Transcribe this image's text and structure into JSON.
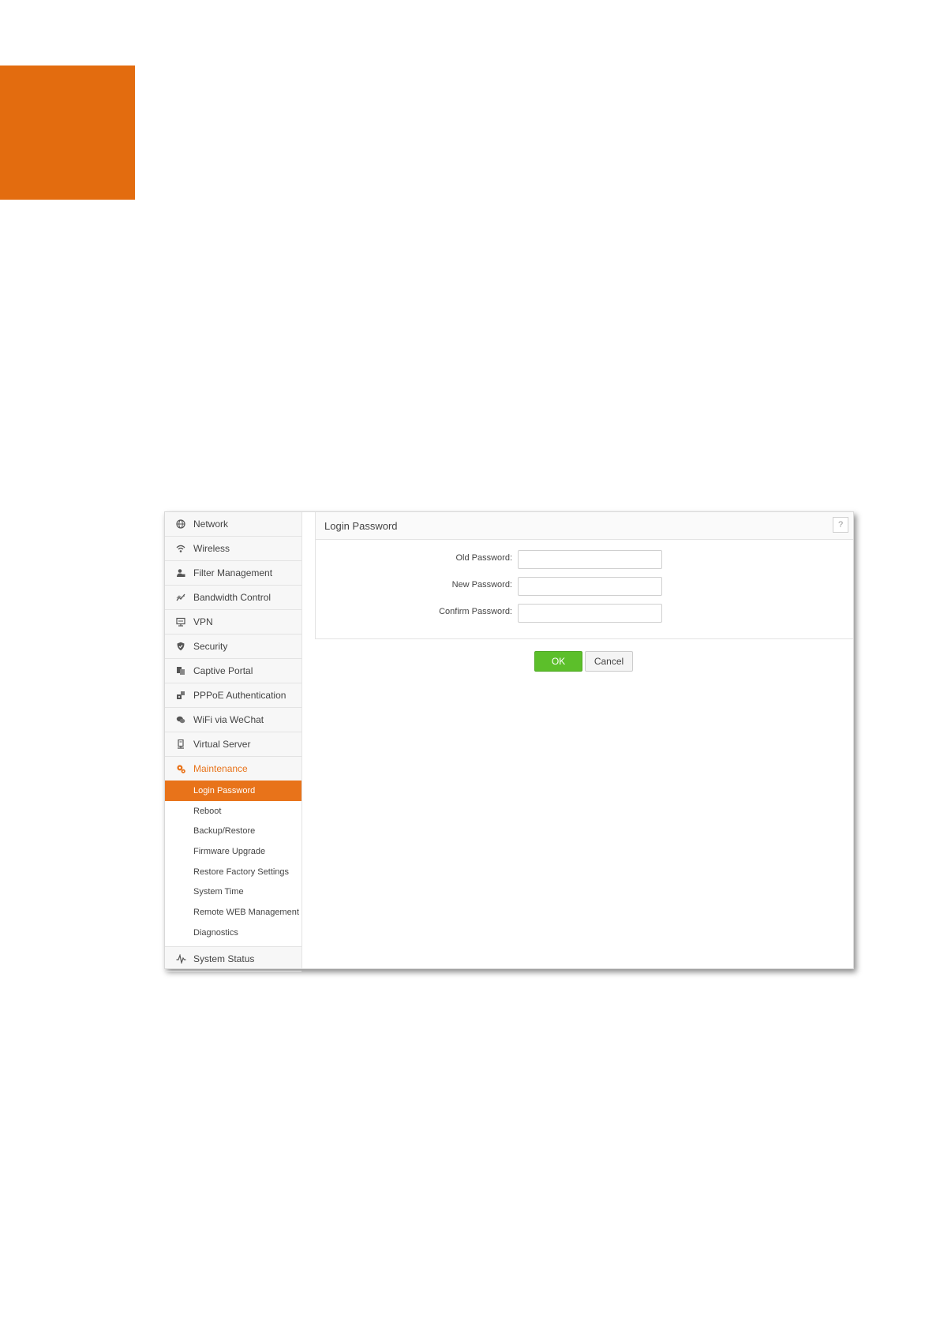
{
  "colors": {
    "brand_orange": "#e36c0f",
    "menu_highlight": "#e8731a",
    "ok_green": "#5cbf2a"
  },
  "sidebar": {
    "items": [
      {
        "label": "Network",
        "icon": "globe-icon"
      },
      {
        "label": "Wireless",
        "icon": "wifi-icon"
      },
      {
        "label": "Filter Management",
        "icon": "user-filter-icon"
      },
      {
        "label": "Bandwidth Control",
        "icon": "bandwidth-icon"
      },
      {
        "label": "VPN",
        "icon": "vpn-icon"
      },
      {
        "label": "Security",
        "icon": "shield-icon"
      },
      {
        "label": "Captive Portal",
        "icon": "portal-icon"
      },
      {
        "label": "PPPoE Authentication",
        "icon": "pppoe-icon"
      },
      {
        "label": "WiFi via WeChat",
        "icon": "wechat-icon"
      },
      {
        "label": "Virtual Server",
        "icon": "server-icon"
      },
      {
        "label": "Maintenance",
        "icon": "maintenance-gear-icon"
      }
    ],
    "maintenance_sub": [
      {
        "label": "Login Password"
      },
      {
        "label": "Reboot"
      },
      {
        "label": "Backup/Restore"
      },
      {
        "label": "Firmware Upgrade"
      },
      {
        "label": "Restore Factory Settings"
      },
      {
        "label": "System Time"
      },
      {
        "label": "Remote WEB Management"
      },
      {
        "label": "Diagnostics"
      }
    ],
    "last_item": {
      "label": "System Status",
      "icon": "pulse-icon"
    }
  },
  "panel": {
    "title": "Login Password",
    "help_label": "?"
  },
  "form": {
    "old_password_label": "Old Password:",
    "new_password_label": "New Password:",
    "confirm_password_label": "Confirm Password:",
    "old_password_value": "",
    "new_password_value": "",
    "confirm_password_value": ""
  },
  "buttons": {
    "ok_label": "OK",
    "cancel_label": "Cancel"
  }
}
